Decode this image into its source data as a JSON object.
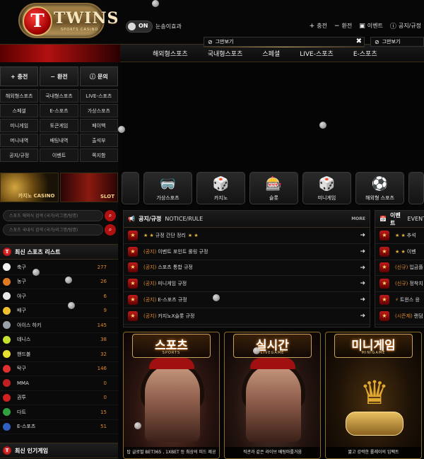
{
  "header": {
    "logo_text": "TWINS",
    "logo_sub": "SPORTS CASINO",
    "logo_letter": "T",
    "toggle_label": "ON",
    "sound_label": "눈송이효과",
    "links": [
      {
        "icon": "plus-icon",
        "glyph": "+",
        "label": "충전"
      },
      {
        "icon": "minus-icon",
        "glyph": "−",
        "label": "환전"
      },
      {
        "icon": "gift-icon",
        "glyph": "▣",
        "label": "이벤트"
      },
      {
        "icon": "info-icon",
        "glyph": "ⓘ",
        "label": "공지/규정"
      }
    ]
  },
  "nav": {
    "items": [
      "해외형스포츠",
      "국내형스포츠",
      "스페셜",
      "LIVE-스포츠",
      "E-스포츠"
    ]
  },
  "popups": [
    {
      "label": "그만보기",
      "close": "✖"
    },
    {
      "label": "그만보기"
    }
  ],
  "sidebar": {
    "actions": [
      {
        "glyph": "+",
        "label": "충전"
      },
      {
        "glyph": "−",
        "label": "환전"
      },
      {
        "glyph": "ⓘ",
        "label": "문의"
      }
    ],
    "menu": [
      "해외형스포츠",
      "국내형스포츠",
      "LIVE-스포츠",
      "스페셜",
      "E-스포츠",
      "가상스포츠",
      "미니게임",
      "토큰게임",
      "페이백",
      "머니내역",
      "배팅내역",
      "출석부",
      "공지/규정",
      "이벤트",
      "쪽지함"
    ],
    "banners": [
      "카지노 CASINO",
      "SLOT"
    ],
    "search1_placeholder": "스포츠 해외식 검색 (국가/리그명/팀명)",
    "search2_placeholder": "스포츠 국내식 검색 (국가/리그명/팀명)",
    "sports_title": "최신 스포츠 리스트",
    "sports": [
      {
        "name": "축구",
        "count": "277",
        "color": "#f2f2f2"
      },
      {
        "name": "농구",
        "count": "26",
        "color": "#e07a22"
      },
      {
        "name": "야구",
        "count": "6",
        "color": "#e8e8e8"
      },
      {
        "name": "배구",
        "count": "9",
        "color": "#f0c030"
      },
      {
        "name": "아이스 하키",
        "count": "145",
        "color": "#9aa0a8"
      },
      {
        "name": "테니스",
        "count": "38",
        "color": "#c8e030"
      },
      {
        "name": "핸드볼",
        "count": "32",
        "color": "#e8e030"
      },
      {
        "name": "탁구",
        "count": "146",
        "color": "#e03030"
      },
      {
        "name": "MMA",
        "count": "0",
        "color": "#c02020"
      },
      {
        "name": "권투",
        "count": "0",
        "color": "#d02020"
      },
      {
        "name": "다트",
        "count": "15",
        "color": "#30a040"
      },
      {
        "name": "E-스포츠",
        "count": "51",
        "color": "#3060c0"
      }
    ],
    "popular_title": "최신 인기게임"
  },
  "categories": [
    {
      "icon": "",
      "label": ""
    },
    {
      "icon": "vr-headset-icon",
      "glyph": "🥽",
      "label": "가상스포츠"
    },
    {
      "icon": "chips-icon",
      "glyph": "🎲",
      "label": "카지노"
    },
    {
      "icon": "slot-machine-icon",
      "glyph": "🎰",
      "label": "슬롯"
    },
    {
      "icon": "dice-icon",
      "glyph": "🎲",
      "label": "미니게임"
    },
    {
      "icon": "soccer-ball-icon",
      "glyph": "⚽",
      "label": "해외형 스포츠"
    },
    {
      "icon": "",
      "label": ""
    }
  ],
  "notice": {
    "title": "공지/규정",
    "sub": "NOTICE/RULE",
    "more": "MORE",
    "rows": [
      {
        "stars_pre": "★ ★",
        "tag": "",
        "text": "규정 간단 정리",
        "stars_post": "★ ★"
      },
      {
        "stars_pre": "",
        "tag": "(공지)",
        "text": "이벤트 포인트 롤링 규정",
        "stars_post": ""
      },
      {
        "stars_pre": "",
        "tag": "(공지)",
        "text": "스포츠 통합 규정",
        "stars_post": ""
      },
      {
        "stars_pre": "",
        "tag": "(공지)",
        "text": "미니게임 규정",
        "stars_post": ""
      },
      {
        "stars_pre": "",
        "tag": "(공지)",
        "text": "E-스포츠 규정",
        "stars_post": ""
      },
      {
        "stars_pre": "",
        "tag": "(공지)",
        "text": "카지노X슬롯 규정",
        "stars_post": ""
      }
    ]
  },
  "event": {
    "title": "이벤트",
    "sub": "EVENT",
    "rows": [
      {
        "stars_pre": "★ ★",
        "tag": "",
        "text": "추석"
      },
      {
        "stars_pre": "★ ★",
        "tag": "",
        "text": "이벤"
      },
      {
        "stars_pre": "",
        "tag": "(신규)",
        "text": "입금플"
      },
      {
        "stars_pre": "",
        "tag": "(신규)",
        "text": "정착지"
      },
      {
        "stars_pre": "",
        "tag": "⚡",
        "text": "트윈스 응"
      },
      {
        "stars_pre": "",
        "tag": "(시즌제)",
        "text": "랜덤"
      }
    ]
  },
  "promos": [
    {
      "title": "스포츠",
      "sub": "SPORTS",
      "caption": "탑 글로벌 BET365 , 1XBET 등 최상의 피드 제공"
    },
    {
      "title": "실시간",
      "sub": "LIVEGAME",
      "caption": "직관과 같은 라이브 베팅마를거움"
    },
    {
      "title": "미니게임",
      "sub": "MINIGAME",
      "caption": "짧고 강력한 롤레이의 임팩트"
    }
  ]
}
